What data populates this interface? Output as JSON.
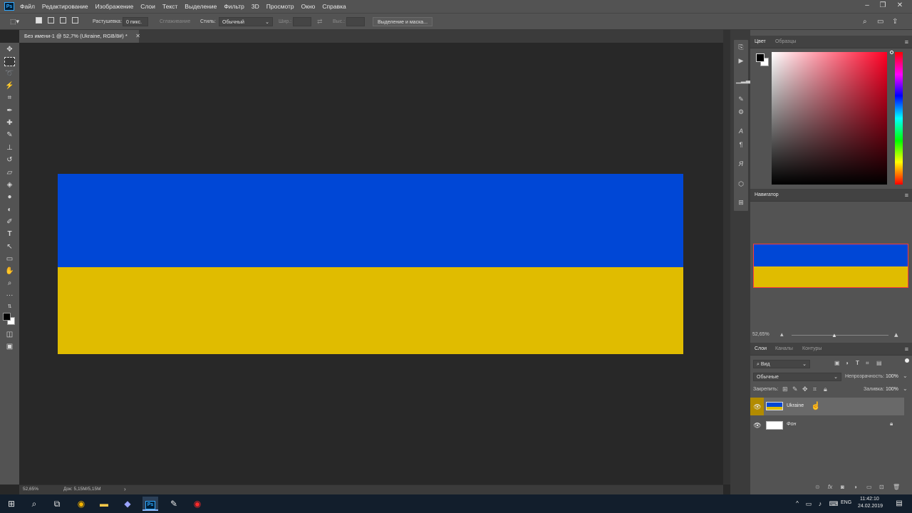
{
  "menu": [
    "Файл",
    "Редактирование",
    "Изображение",
    "Слои",
    "Текст",
    "Выделение",
    "Фильтр",
    "3D",
    "Просмотр",
    "Окно",
    "Справка"
  ],
  "app_icon": "Ps",
  "options": {
    "feather_label": "Растушевка:",
    "feather_value": "0 пикс.",
    "antialias_label": "Сглаживание",
    "style_label": "Стиль:",
    "style_value": "Обычный",
    "width_label": "Шир.:",
    "height_label": "Выс.:",
    "select_mask_button": "Выделение и маска..."
  },
  "document": {
    "tab_title": "Без имени-1 @ 52,7% (Ukraine, RGB/8#) *",
    "colors": {
      "top": "#0047d6",
      "bottom": "#e0bc00"
    }
  },
  "status": {
    "zoom": "52,65%",
    "doc_size": "Док: 5,15M/5,15M"
  },
  "color_panel": {
    "tab_active": "Цвет",
    "tab_other": "Образцы"
  },
  "navigator": {
    "title": "Навигатор",
    "zoom": "52,65%"
  },
  "layers_panel": {
    "tabs": [
      "Слои",
      "Каналы",
      "Контуры"
    ],
    "filter_placeholder": "Вид",
    "blend_mode": "Обычные",
    "opacity_label": "Непрозрачность:",
    "opacity_value": "100%",
    "lock_label": "Закрепить:",
    "fill_label": "Заливка:",
    "fill_value": "100%",
    "layers": [
      {
        "name": "Ukraine",
        "selected": true,
        "locked": false
      },
      {
        "name": "Фон",
        "selected": false,
        "locked": true
      }
    ]
  },
  "taskbar": {
    "lang": "ENG",
    "time": "11:42:10",
    "date": "24.02.2019"
  }
}
